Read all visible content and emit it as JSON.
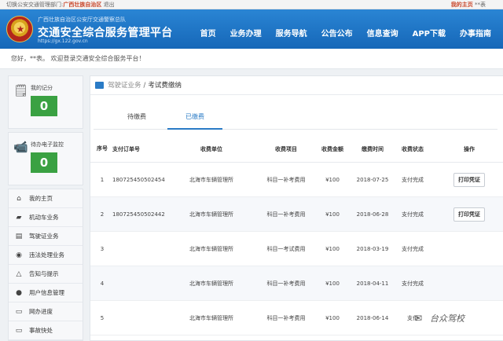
{
  "topbar": {
    "switch_prefix": "切换公安交通管理部门:",
    "region": "广西壮族自治区",
    "exit": "退出",
    "my_home": "我的主页",
    "user_mask": "**表"
  },
  "header": {
    "org_name": "广西壮族自治区公安厅交通警察总队",
    "site_title": "交通安全综合服务管理平台",
    "site_url": "https://gx.122.gov.cn",
    "nav": [
      "首页",
      "业务办理",
      "服务导航",
      "公告公布",
      "信息查询",
      "APP下载",
      "办事指南"
    ]
  },
  "welcome": "您好，**表。  欢迎登录交通安全综合服务平台！",
  "sidebar": {
    "cards": [
      {
        "label": "我的记分",
        "value": "0",
        "icon": "license-icon"
      },
      {
        "label": "待办电子监控",
        "value": "0",
        "icon": "camera-icon"
      }
    ],
    "menu": [
      {
        "label": "我的主页",
        "icon": "home-icon"
      },
      {
        "label": "机动车业务",
        "icon": "truck-icon"
      },
      {
        "label": "驾驶证业务",
        "icon": "id-card-icon"
      },
      {
        "label": "违法处理业务",
        "icon": "camera-icon"
      },
      {
        "label": "告知与提示",
        "icon": "bell-icon"
      },
      {
        "label": "用户信息管理",
        "icon": "user-icon"
      },
      {
        "label": "网办进度",
        "icon": "progress-icon"
      },
      {
        "label": "事故快处",
        "icon": "accident-icon"
      }
    ]
  },
  "breadcrumb": {
    "first": "驾驶证业务",
    "current": "考试费缴纳"
  },
  "tabs": {
    "unpaid": "待缴费",
    "paid": "已缴费"
  },
  "table": {
    "headers": {
      "seq": "序号",
      "order": "支付订单号",
      "unit": "收费单位",
      "item": "收费项目",
      "amount": "收费金额",
      "time": "缴费时间",
      "status": "收费状态",
      "op": "操作"
    },
    "rows": [
      {
        "seq": "1",
        "order": "180725450502454",
        "unit": "北海市车辆管理所",
        "item": "科目一补考费用",
        "amount": "¥100",
        "time": "2018-07-25",
        "status": "支付完成",
        "op": "打印凭证"
      },
      {
        "seq": "2",
        "order": "180725450502442",
        "unit": "北海市车辆管理所",
        "item": "科目一补考费用",
        "amount": "¥100",
        "time": "2018-06-28",
        "status": "支付完成",
        "op": "打印凭证"
      },
      {
        "seq": "3",
        "order": "",
        "unit": "北海市车辆管理所",
        "item": "科目一考试费用",
        "amount": "¥100",
        "time": "2018-03-19",
        "status": "支付完成",
        "op": ""
      },
      {
        "seq": "4",
        "order": "",
        "unit": "北海市车辆管理所",
        "item": "科目一补考费用",
        "amount": "¥100",
        "time": "2018-04-11",
        "status": "支付完成",
        "op": ""
      },
      {
        "seq": "5",
        "order": "",
        "unit": "北海市车辆管理所",
        "item": "科目一补考费用",
        "amount": "¥100",
        "time": "2018-06-14",
        "status": "支付",
        "op": ""
      }
    ]
  },
  "watermark": "台众驾校"
}
